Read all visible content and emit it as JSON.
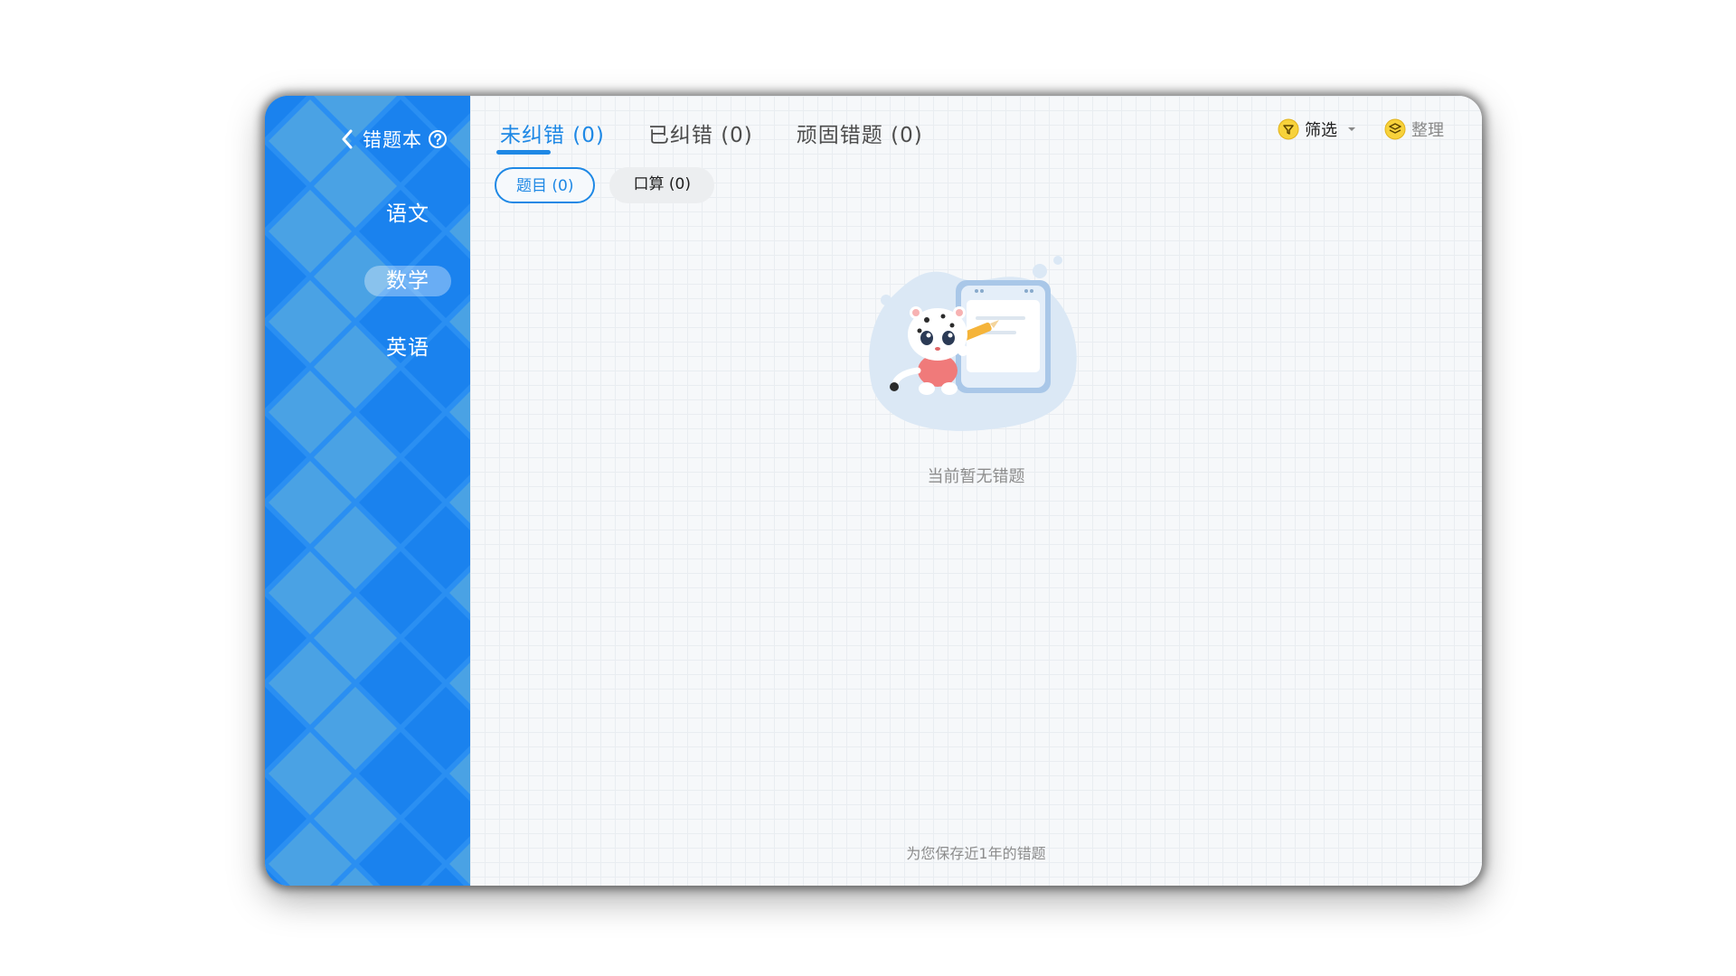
{
  "sidebar": {
    "title": "错题本",
    "back_icon": "chevron-left-icon",
    "help_icon": "question-circle-icon",
    "subjects": [
      {
        "label": "语文",
        "active": false
      },
      {
        "label": "数学",
        "active": true
      },
      {
        "label": "英语",
        "active": false
      }
    ],
    "colors": {
      "base": "#2a8ff2",
      "tile_dark": "#1a82ee",
      "tile_light": "#4aa2e4"
    }
  },
  "tabs": [
    {
      "label": "未纠错 (0)",
      "active": true
    },
    {
      "label": "已纠错 (0)",
      "active": false
    },
    {
      "label": "顽固错题 (0)",
      "active": false
    }
  ],
  "subtabs": [
    {
      "label": "题目 (0)",
      "active": true
    },
    {
      "label": "口算 (0)",
      "active": false
    }
  ],
  "tools": {
    "filter": {
      "label": "筛选",
      "icon": "filter-coin-icon",
      "caret": "caret-down-icon"
    },
    "organize": {
      "label": "整理",
      "icon": "layers-coin-icon"
    }
  },
  "empty_state": {
    "illustration": "snow-leopard-with-pencil-illustration",
    "message": "当前暂无错题"
  },
  "footer": {
    "note": "为您保存近1年的错题"
  },
  "accent_color": "#1e88e5"
}
